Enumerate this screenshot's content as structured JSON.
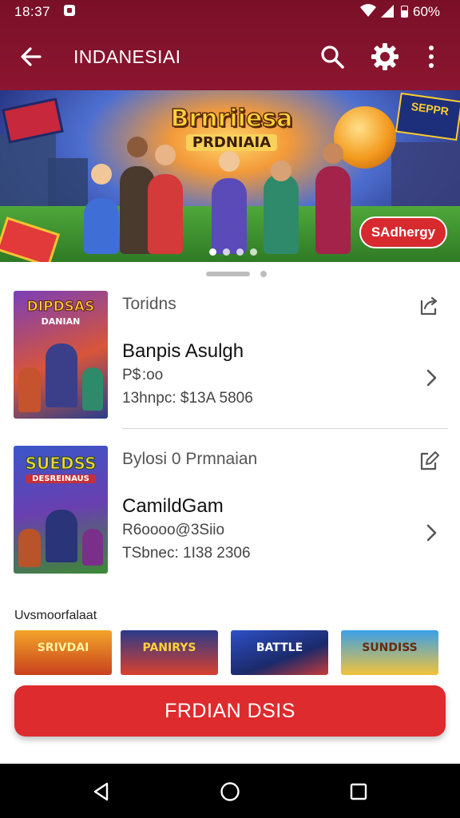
{
  "status_bar": {
    "time": "18:37",
    "battery": "60%",
    "battery_level": 0.6
  },
  "app_bar": {
    "title": "INDANESIAI"
  },
  "banner": {
    "title_line1": "Brnriiesa",
    "title_line2": "PRDNIAIA",
    "corner_badge": "SEPPR",
    "cta_label": "SAdhergy",
    "page_count": 4,
    "active_page": 0
  },
  "cards": [
    {
      "thumb_title": "DIPDSAS",
      "thumb_subtitle": "DANIAN",
      "category": "Toridns",
      "name": "Banpis Asulgh",
      "price": "P$ :oo",
      "meta": "13hnpc: $13A 5806",
      "top_icon": "share-icon"
    },
    {
      "thumb_title": "SUEDSS",
      "thumb_subtitle": "DESREINAUS",
      "category": "Bylosi 0 Prmnaian",
      "name": "CamildGam",
      "price": "R6oooo@3Siio",
      "meta": "TSbnec: 1I38 2306",
      "top_icon": "edit-icon"
    }
  ],
  "section": {
    "title": "Uvsmoorfalaat",
    "tiles": [
      "SRIVDAI",
      "PANIRYS",
      "BATTLE",
      "SUNDISS"
    ]
  },
  "primary_button": {
    "label": "FRDIAN DSIS"
  },
  "colors": {
    "brand": "#8c1530",
    "accent": "#dd2b2e"
  }
}
